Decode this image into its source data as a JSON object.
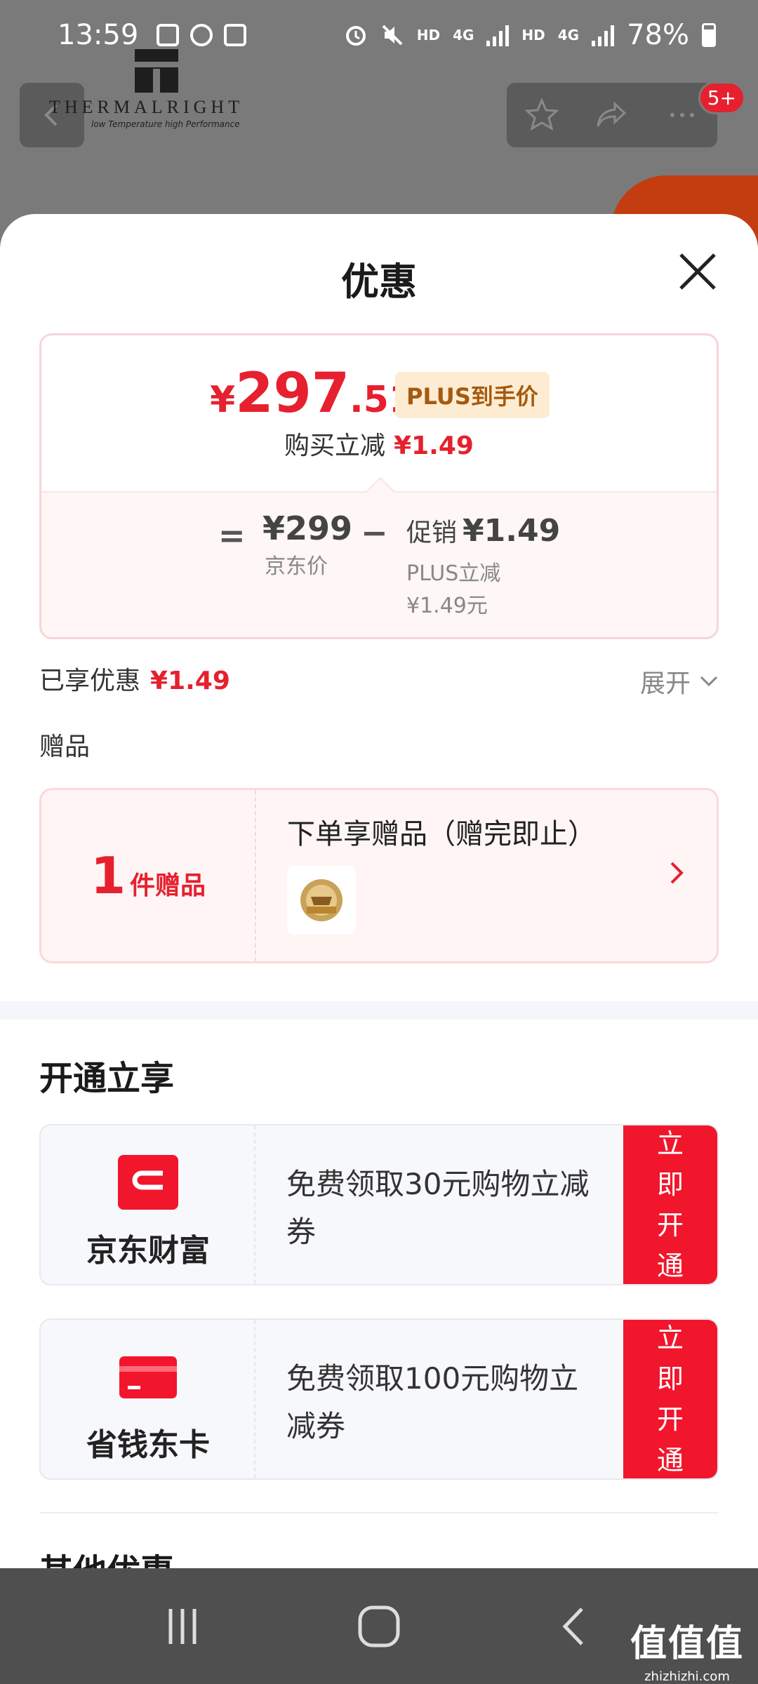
{
  "status_bar": {
    "time": "13:59",
    "network_label_1": "HD",
    "network_label_2": "4G",
    "network_label_3": "HD",
    "network_label_4": "4G",
    "battery": "78%"
  },
  "header": {
    "brand_name": "THERMALRIGHT",
    "brand_tagline": "low Temperature high Performance",
    "message_badge": "5+"
  },
  "sheet": {
    "title": "优惠",
    "price": {
      "currency": "¥",
      "integer": "297",
      "decimal": ".51",
      "badge": "PLUS到手价",
      "instant_label": "购买立减",
      "instant_amount": "¥1.49"
    },
    "breakdown": {
      "equals": "=",
      "jd_price": "¥299",
      "jd_price_label": "京东价",
      "minus": "−",
      "promo_label": "促销",
      "promo_amount": "¥1.49",
      "plus_label": "PLUS立减",
      "plus_amount": "¥1.49元"
    },
    "enjoyed_label": "已享优惠",
    "enjoyed_amount": "¥1.49",
    "expand_label": "展开",
    "gift_heading": "赠品",
    "gift": {
      "count": "1",
      "unit": "件赠品",
      "title": "下单享赠品（赠完即止）"
    },
    "open_heading": "开通立享",
    "offers": [
      {
        "name": "京东财富",
        "desc": "免费领取30元购物立减券",
        "button": "立即开通"
      },
      {
        "name": "省钱东卡",
        "desc": "免费领取100元购物立减券",
        "button": "立即开通"
      }
    ],
    "other_heading": "其他优惠"
  },
  "watermark": {
    "title": "值值值",
    "url": "zhizhizhi.com"
  },
  "colors": {
    "accent_red": "#e6202e",
    "button_red": "#f1162c",
    "plus_badge_bg": "#fdecd2",
    "plus_badge_text": "#a55a10"
  },
  "icons": [
    "back-arrow-icon",
    "star-icon",
    "share-icon",
    "more-icon",
    "close-icon",
    "chevron-down-icon",
    "chevron-right-icon",
    "jd-wealth-icon",
    "card-icon",
    "recent-apps-icon",
    "home-icon",
    "back-nav-icon"
  ]
}
